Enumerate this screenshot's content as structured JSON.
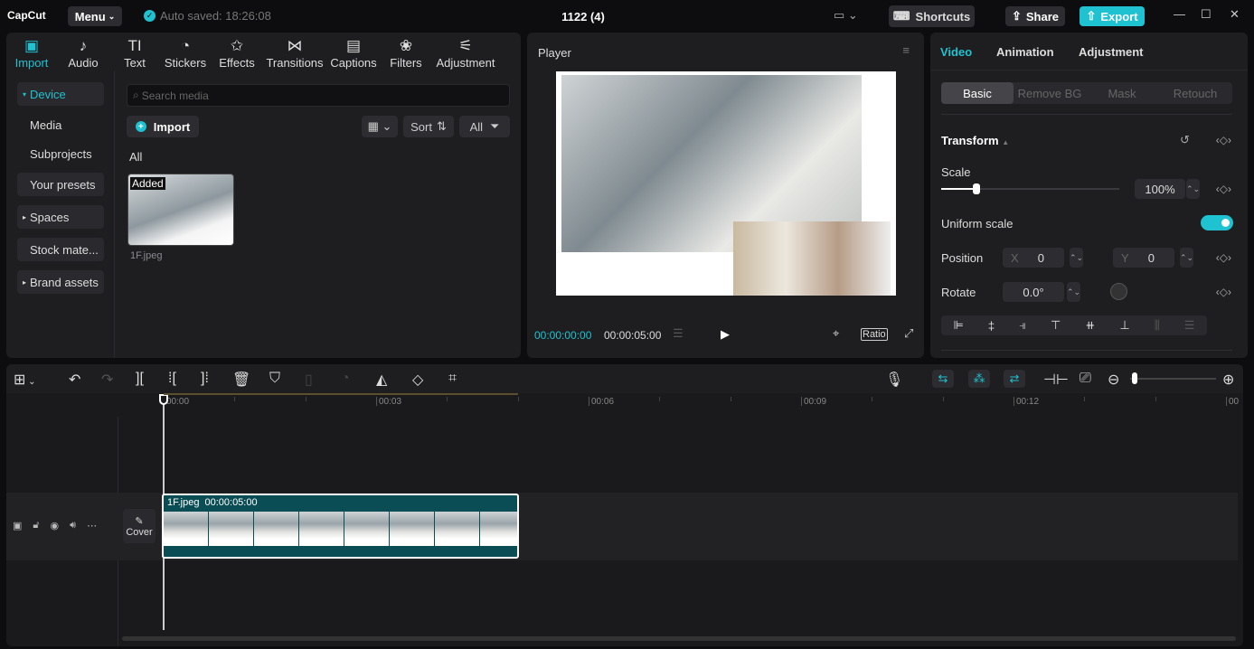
{
  "app": {
    "logo": "CapCut",
    "menu": "Menu",
    "autosave": "Auto saved: 18:26:08",
    "project_title": "1122 (4)",
    "shortcuts": "Shortcuts",
    "share": "Share",
    "export": "Export"
  },
  "toolbar": [
    {
      "label": "Import",
      "icon": "import-icon",
      "active": true
    },
    {
      "label": "Audio",
      "icon": "audio-icon"
    },
    {
      "label": "Text",
      "icon": "text-icon"
    },
    {
      "label": "Stickers",
      "icon": "stickers-icon"
    },
    {
      "label": "Effects",
      "icon": "effects-icon"
    },
    {
      "label": "Transitions",
      "icon": "transitions-icon"
    },
    {
      "label": "Captions",
      "icon": "captions-icon"
    },
    {
      "label": "Filters",
      "icon": "filters-icon"
    },
    {
      "label": "Adjustment",
      "icon": "adjustment-icon"
    }
  ],
  "sidebar": [
    "Device",
    "Media",
    "Subprojects",
    "Your presets",
    "Spaces",
    "Stock mate...",
    "Brand assets"
  ],
  "media": {
    "search_placeholder": "Search media",
    "import": "Import",
    "sort": "Sort",
    "all": "All",
    "section": "All",
    "item_name": "1F.jpeg",
    "item_badge": "Added"
  },
  "player": {
    "title": "Player",
    "current_time": "00:00:00:00",
    "duration": "00:00:05:00",
    "ratio": "Ratio"
  },
  "inspector": {
    "tabs": [
      "Video",
      "Animation",
      "Adjustment"
    ],
    "subtabs": [
      "Basic",
      "Remove BG",
      "Mask",
      "Retouch"
    ],
    "section": "Transform",
    "scale_label": "Scale",
    "scale_value": "100%",
    "scale_fraction": 0.2,
    "uniform_label": "Uniform scale",
    "uniform_on": true,
    "position_label": "Position",
    "x_label": "X",
    "x_value": "0",
    "y_label": "Y",
    "y_value": "0",
    "rotate_label": "Rotate",
    "rotate_value": "0.0°"
  },
  "timeline": {
    "ruler": [
      "00:00",
      "00:03",
      "00:06",
      "00:09",
      "00:12",
      "00"
    ],
    "clip_name": "1F.jpeg",
    "clip_duration": "00:00:05:00",
    "cover": "Cover"
  },
  "colors": {
    "accent": "#1fc2d0",
    "clip": "#0b4d55"
  }
}
